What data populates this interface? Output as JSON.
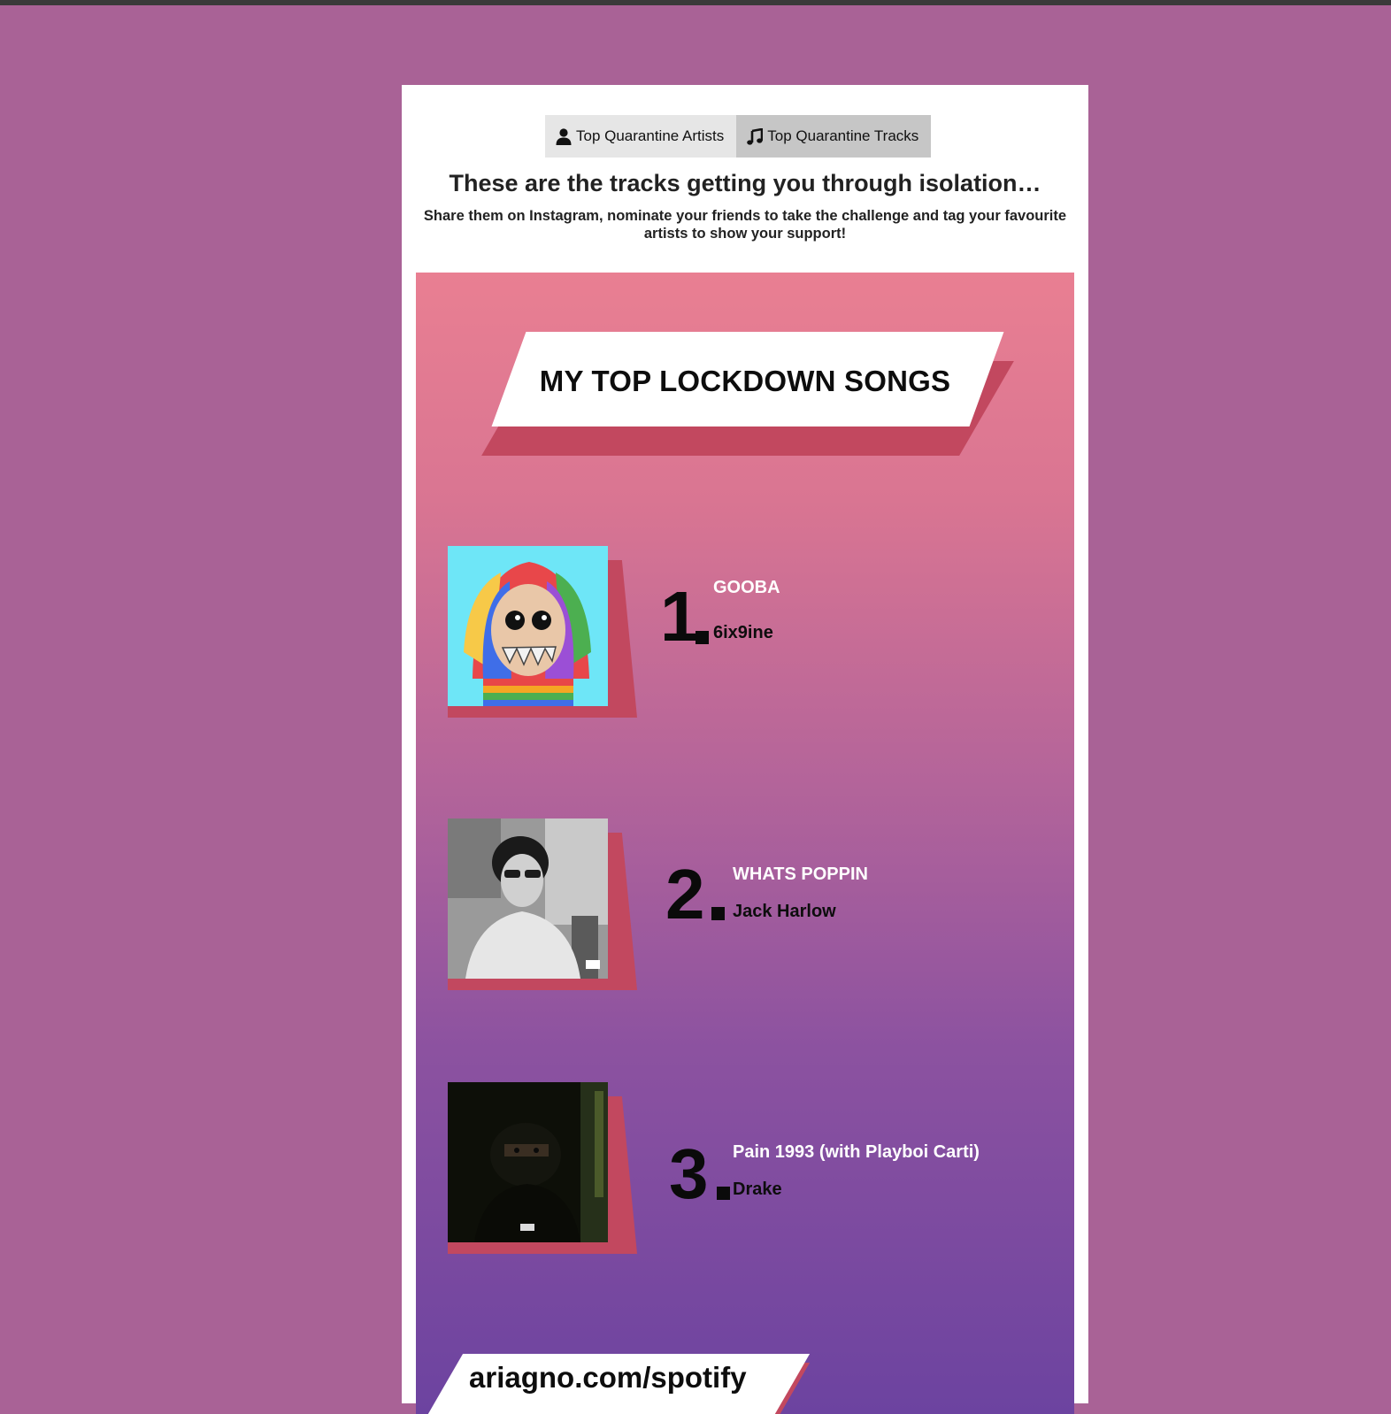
{
  "tabs": [
    {
      "label": "Top Quarantine Artists",
      "icon": "person-icon",
      "active": false
    },
    {
      "label": "Top Quarantine Tracks",
      "icon": "music-note-icon",
      "active": true
    }
  ],
  "heading": "These are the tracks getting you through isolation…",
  "subheading": "Share them on Instagram, nominate your friends to take the challenge and tag your favourite artists to show your support!",
  "poster": {
    "banner_title": "MY TOP LOCKDOWN SONGS",
    "tracks": [
      {
        "rank": "1",
        "title": "GOOBA",
        "artist": "6ix9ine",
        "art": "album-art-gooba"
      },
      {
        "rank": "2",
        "title": "WHATS POPPIN",
        "artist": "Jack Harlow",
        "art": "album-art-whats-poppin"
      },
      {
        "rank": "3",
        "title": "Pain 1993 (with Playboi Carti)",
        "artist": "Drake",
        "art": "album-art-pain-1993"
      }
    ],
    "footer_url": "ariagno.com/spotify"
  },
  "colors": {
    "page_background": "#a96296",
    "poster_top": "#e97f92",
    "poster_bottom": "#6c43a0",
    "accent_shadow": "#c2485f",
    "tab_active": "#c6c6c6",
    "tab_inactive": "#e6e6e6"
  }
}
